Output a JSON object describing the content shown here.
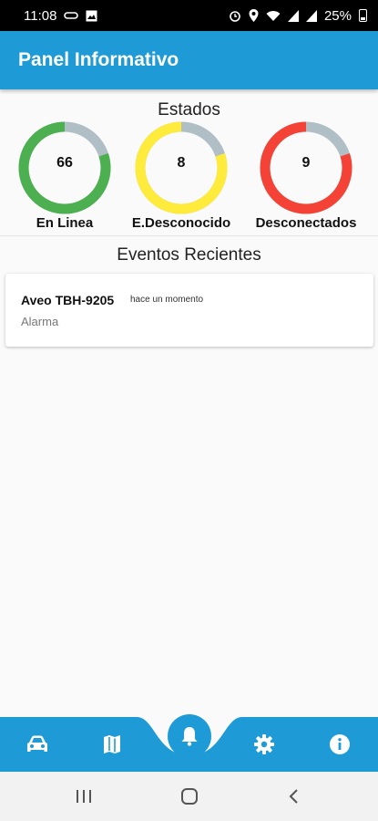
{
  "status_bar": {
    "time": "11:08",
    "battery": "25%",
    "icons": [
      "link-icon",
      "image-icon",
      "alarm-icon",
      "location-icon",
      "wifi-icon",
      "signal-icon",
      "signal-icon",
      "battery-icon"
    ]
  },
  "app_bar": {
    "title": "Panel Informativo"
  },
  "estados": {
    "title": "Estados",
    "gauges": [
      {
        "label": "En Linea",
        "value": "66",
        "color": "#4caf50",
        "fill_fraction": 0.8
      },
      {
        "label": "E.Desconocido",
        "value": "8",
        "color": "#ffeb3b",
        "fill_fraction": 0.8
      },
      {
        "label": "Desconectados",
        "value": "9",
        "color": "#f44336",
        "fill_fraction": 0.8
      }
    ],
    "track_color": "#b0bec5"
  },
  "eventos": {
    "title": "Eventos Recientes",
    "items": [
      {
        "title": "Aveo TBH-9205",
        "time": "hace un momento",
        "type": "Alarma"
      }
    ]
  },
  "bottom_nav": {
    "accent": "#1e9bd7",
    "items": [
      "car-icon",
      "map-icon",
      "bell-icon",
      "gear-icon",
      "info-icon"
    ],
    "active": "bell-icon"
  },
  "system_nav": {
    "items": [
      "recents-icon",
      "home-icon",
      "back-icon"
    ]
  }
}
